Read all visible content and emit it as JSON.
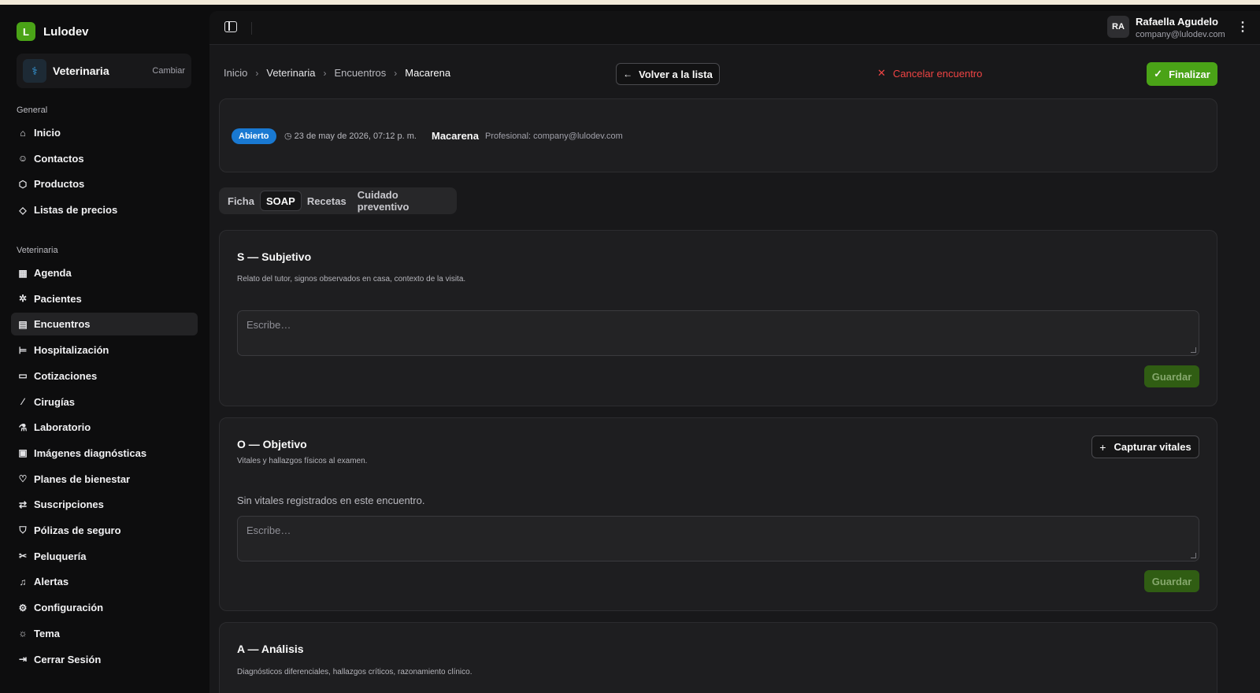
{
  "brand": {
    "logo_letter": "L",
    "name": "Lulodev"
  },
  "workspace": {
    "icon": "stethoscope-icon",
    "name": "Veterinaria",
    "switch_label": "Cambiar"
  },
  "sidebar": {
    "general_label": "General",
    "general_items": [
      {
        "icon": "home-icon",
        "glyph": "⌂",
        "label": "Inicio"
      },
      {
        "icon": "contacts-icon",
        "glyph": "☺",
        "label": "Contactos"
      },
      {
        "icon": "box-icon",
        "glyph": "⬡",
        "label": "Productos"
      },
      {
        "icon": "tag-icon",
        "glyph": "◇",
        "label": "Listas de precios"
      }
    ],
    "vet_label": "Veterinaria",
    "vet_items": [
      {
        "icon": "calendar-icon",
        "glyph": "▦",
        "label": "Agenda"
      },
      {
        "icon": "paw-icon",
        "glyph": "✲",
        "label": "Pacientes"
      },
      {
        "icon": "clipboard-icon",
        "glyph": "▤",
        "label": "Encuentros",
        "active": true
      },
      {
        "icon": "bed-icon",
        "glyph": "⊨",
        "label": "Hospitalización"
      },
      {
        "icon": "file-icon",
        "glyph": "▭",
        "label": "Cotizaciones"
      },
      {
        "icon": "scalpel-icon",
        "glyph": "∕",
        "label": "Cirugías"
      },
      {
        "icon": "flask-icon",
        "glyph": "⚗",
        "label": "Laboratorio"
      },
      {
        "icon": "image-icon",
        "glyph": "▣",
        "label": "Imágenes diagnósticas"
      },
      {
        "icon": "heart-icon",
        "glyph": "♡",
        "label": "Planes de bienestar"
      },
      {
        "icon": "repeat-icon",
        "glyph": "⇄",
        "label": "Suscripciones"
      },
      {
        "icon": "shield-icon",
        "glyph": "⛉",
        "label": "Pólizas de seguro"
      },
      {
        "icon": "scissors-icon",
        "glyph": "✂",
        "label": "Peluquería"
      },
      {
        "icon": "bell-icon",
        "glyph": "♫",
        "label": "Alertas"
      },
      {
        "icon": "gear-icon",
        "glyph": "⚙",
        "label": "Configuración"
      },
      {
        "icon": "sun-icon",
        "glyph": "☼",
        "label": "Tema"
      },
      {
        "icon": "logout-icon",
        "glyph": "⇥",
        "label": "Cerrar Sesión"
      }
    ]
  },
  "user": {
    "initials": "RA",
    "name": "Rafaella Agudelo",
    "email": "company@lulodev.com"
  },
  "breadcrumb": [
    "Inicio",
    "Veterinaria",
    "Encuentros",
    "Macarena"
  ],
  "actions": {
    "back_label": "Volver a la lista",
    "cancel_label": "Cancelar encuentro",
    "finish_label": "Finalizar"
  },
  "encounter": {
    "status": "Abierto",
    "status_color": "#1979d2",
    "datetime": "23 de may de 2026, 07:12 p. m.",
    "patient": "Macarena",
    "professional": "Profesional: company@lulodev.com"
  },
  "tabs": [
    {
      "label": "Ficha"
    },
    {
      "label": "SOAP",
      "active": true
    },
    {
      "label": "Recetas"
    },
    {
      "label": "Cuidado preventivo"
    }
  ],
  "soap": {
    "subjective": {
      "title": "S — Subjetivo",
      "description": "Relato del tutor, signos observados en casa, contexto de la visita.",
      "placeholder": "Escribe…",
      "save_label": "Guardar"
    },
    "objective": {
      "title": "O — Objetivo",
      "description": "Vitales y hallazgos físicos al examen.",
      "capture_label": "Capturar vitales",
      "empty_note": "Sin vitales registrados en este encuentro.",
      "placeholder": "Escribe…",
      "save_label": "Guardar"
    },
    "analysis": {
      "title": "A — Análisis",
      "description": "Diagnósticos diferenciales, hallazgos críticos, razonamiento clínico."
    }
  },
  "colors": {
    "brand_green": "#4aa317",
    "danger": "#ef4444",
    "accent_blue": "#1979d2"
  }
}
